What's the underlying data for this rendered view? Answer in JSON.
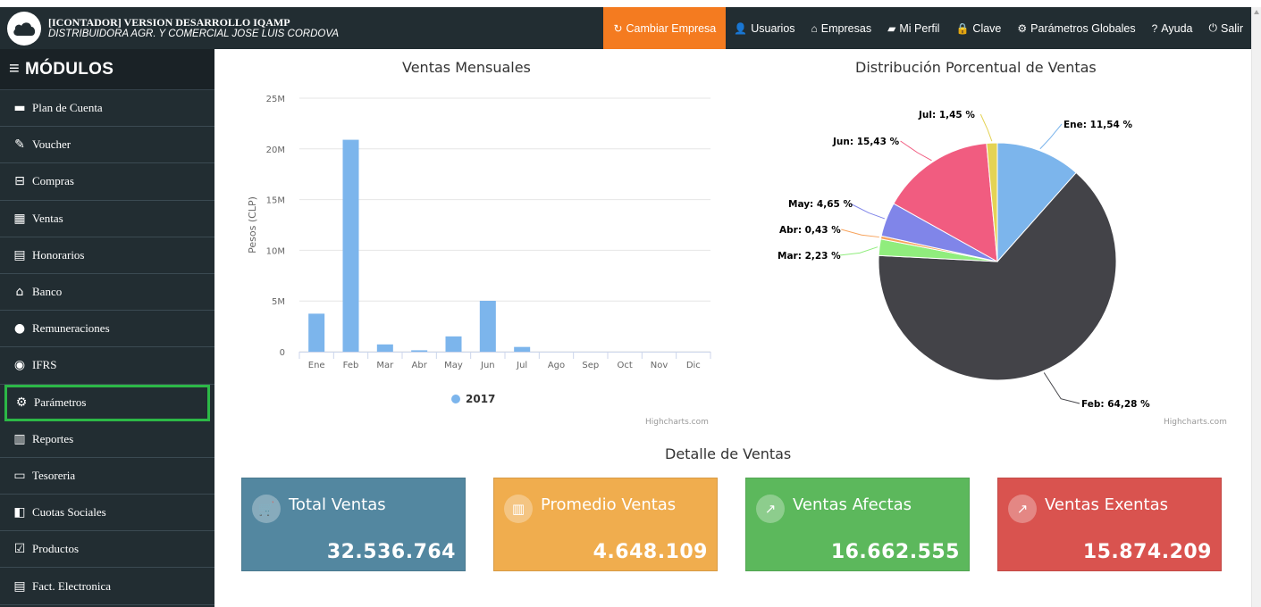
{
  "header": {
    "title": "[ICONTADOR] VERSION DESARROLLO IQAMP",
    "subtitle": "DISTRIBUIDORA AGR. Y COMERCIAL JOSE LUIS CORDOVA",
    "nav": [
      {
        "label": "Cambiar Empresa",
        "icon": "refresh-icon",
        "glyph": "↻",
        "active": true
      },
      {
        "label": "Usuarios",
        "icon": "user-icon",
        "glyph": "👤",
        "active": false
      },
      {
        "label": "Empresas",
        "icon": "home-icon",
        "glyph": "⌂",
        "active": false
      },
      {
        "label": "Mi Perfil",
        "icon": "folder-open-icon",
        "glyph": "▰",
        "active": false
      },
      {
        "label": "Clave",
        "icon": "lock-icon",
        "glyph": "🔒",
        "active": false
      },
      {
        "label": "Parámetros Globales",
        "icon": "gear-icon",
        "glyph": "⚙",
        "active": false
      },
      {
        "label": "Ayuda",
        "icon": "question-icon",
        "glyph": "?",
        "active": false
      },
      {
        "label": "Salir",
        "icon": "power-icon",
        "glyph": "⏻",
        "active": false
      }
    ],
    "accent_color": "#f47b20"
  },
  "sidebar": {
    "header_label": "MÓDULOS",
    "items": [
      {
        "label": "Plan de Cuenta",
        "icon": "folder-icon",
        "glyph": "▬"
      },
      {
        "label": "Voucher",
        "icon": "ticket-icon",
        "glyph": "✎"
      },
      {
        "label": "Compras",
        "icon": "basket-icon",
        "glyph": "⊟"
      },
      {
        "label": "Ventas",
        "icon": "calculator-icon",
        "glyph": "▦"
      },
      {
        "label": "Honorarios",
        "icon": "file-icon",
        "glyph": "▤"
      },
      {
        "label": "Banco",
        "icon": "bank-icon",
        "glyph": "⌂"
      },
      {
        "label": "Remuneraciones",
        "icon": "users-icon",
        "glyph": "●"
      },
      {
        "label": "IFRS",
        "icon": "globe-icon",
        "glyph": "◉"
      },
      {
        "label": "Parámetros",
        "icon": "gear-icon",
        "glyph": "⚙",
        "selected": true
      },
      {
        "label": "Reportes",
        "icon": "bar-chart-icon",
        "glyph": "▥"
      },
      {
        "label": "Tesoreria",
        "icon": "credit-card-icon",
        "glyph": "▭"
      },
      {
        "label": "Cuotas Sociales",
        "icon": "share-icon",
        "glyph": "◧"
      },
      {
        "label": "Productos",
        "icon": "check-square-icon",
        "glyph": "☑"
      },
      {
        "label": "Fact. Electronica",
        "icon": "file-text-icon",
        "glyph": "▤"
      }
    ],
    "highlight_color": "#2cb847"
  },
  "chart_data": [
    {
      "type": "bar",
      "title": "Ventas Mensuales",
      "ylabel": "Pesos (CLP)",
      "xlabel": "",
      "categories": [
        "Ene",
        "Feb",
        "Mar",
        "Abr",
        "May",
        "Jun",
        "Jul",
        "Ago",
        "Sep",
        "Oct",
        "Nov",
        "Dic"
      ],
      "series": [
        {
          "name": "2017",
          "color": "#7cb5ec",
          "values": [
            3750000,
            20900000,
            720000,
            140000,
            1510000,
            5020000,
            470000,
            0,
            0,
            0,
            0,
            0
          ]
        }
      ],
      "ylim": [
        0,
        25000000
      ],
      "yticks": [
        0,
        5000000,
        10000000,
        15000000,
        20000000,
        25000000
      ],
      "ytick_labels": [
        "0",
        "5M",
        "10M",
        "15M",
        "20M",
        "25M"
      ],
      "grid": true,
      "legend": "bottom-center",
      "credits": "Highcharts.com"
    },
    {
      "type": "pie",
      "title": "Distribución Porcentual de Ventas",
      "slices": [
        {
          "label": "Ene",
          "value": 11.54,
          "text": "Ene: 11,54 %",
          "color": "#7cb5ec"
        },
        {
          "label": "Feb",
          "value": 64.28,
          "text": "Feb: 64,28 %",
          "color": "#434348"
        },
        {
          "label": "Mar",
          "value": 2.23,
          "text": "Mar: 2,23 %",
          "color": "#90ed7d"
        },
        {
          "label": "Abr",
          "value": 0.43,
          "text": "Abr: 0,43 %",
          "color": "#f7a35c"
        },
        {
          "label": "May",
          "value": 4.65,
          "text": "May: 4,65 %",
          "color": "#8085e9"
        },
        {
          "label": "Jun",
          "value": 15.43,
          "text": "Jun: 15,43 %",
          "color": "#f15c80"
        },
        {
          "label": "Jul",
          "value": 1.45,
          "text": "Jul: 1,45 %",
          "color": "#e4d354"
        }
      ],
      "credits": "Highcharts.com"
    }
  ],
  "detail": {
    "title": "Detalle de Ventas",
    "cards": [
      {
        "title": "Total Ventas",
        "value": "32.536.764",
        "icon": "cart-icon",
        "glyph": "🛒",
        "color": "#5387a0"
      },
      {
        "title": "Promedio Ventas",
        "value": "4.648.109",
        "icon": "bar-chart-icon",
        "glyph": "▥",
        "color": "#f0ad4e"
      },
      {
        "title": "Ventas Afectas",
        "value": "16.662.555",
        "icon": "line-chart-icon",
        "glyph": "↗",
        "color": "#5cb85c"
      },
      {
        "title": "Ventas Exentas",
        "value": "15.874.209",
        "icon": "line-chart-icon",
        "glyph": "↗",
        "color": "#d9534f"
      }
    ]
  }
}
